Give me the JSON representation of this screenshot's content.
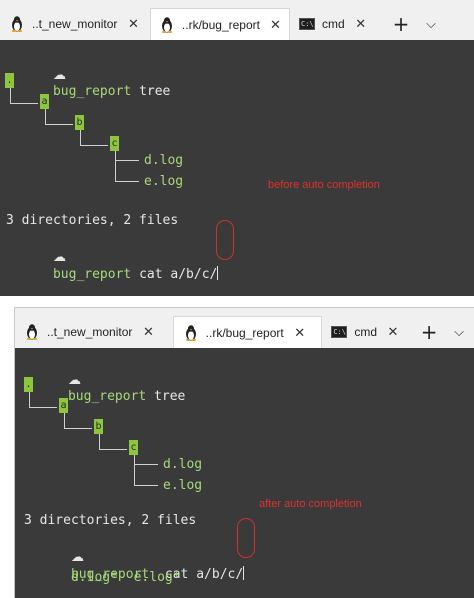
{
  "tabs": [
    {
      "label": "..t_new_monitor",
      "icon": "linux-tux-icon",
      "active": false
    },
    {
      "label": "..rk/bug_report",
      "icon": "linux-tux-icon",
      "active": true
    },
    {
      "label": "cmd",
      "icon": "cmd-icon",
      "active": false
    }
  ],
  "tab_close_glyph": "✕",
  "new_tab_glyph": "+",
  "dropdown_glyph": "⌵",
  "top": {
    "prompt_dir": "bug_report",
    "command1": "tree",
    "tree": {
      "root": ".",
      "a": "a",
      "b": "b",
      "c": "c",
      "file1": "d.log",
      "file2": "e.log"
    },
    "summary": "3 directories, 2 files",
    "command2": "cat a/b/c/",
    "annotation": "before auto completion"
  },
  "bottom": {
    "prompt_dir": "bug_report",
    "command1": "tree",
    "tree": {
      "root": ".",
      "a": "a",
      "b": "b",
      "c": "c",
      "file1": "d.log",
      "file2": "e.log"
    },
    "summary": "3 directories, 2 files",
    "command2": "cat a/b/c/",
    "completions": [
      "d.log*",
      "e.log*"
    ],
    "annotation": "after auto completion"
  },
  "colors": {
    "terminal_bg": "#3a3a3a",
    "prompt_green": "#a7d97a",
    "dir_highlight": "#8cc63f",
    "annotation_red": "#e03030"
  }
}
